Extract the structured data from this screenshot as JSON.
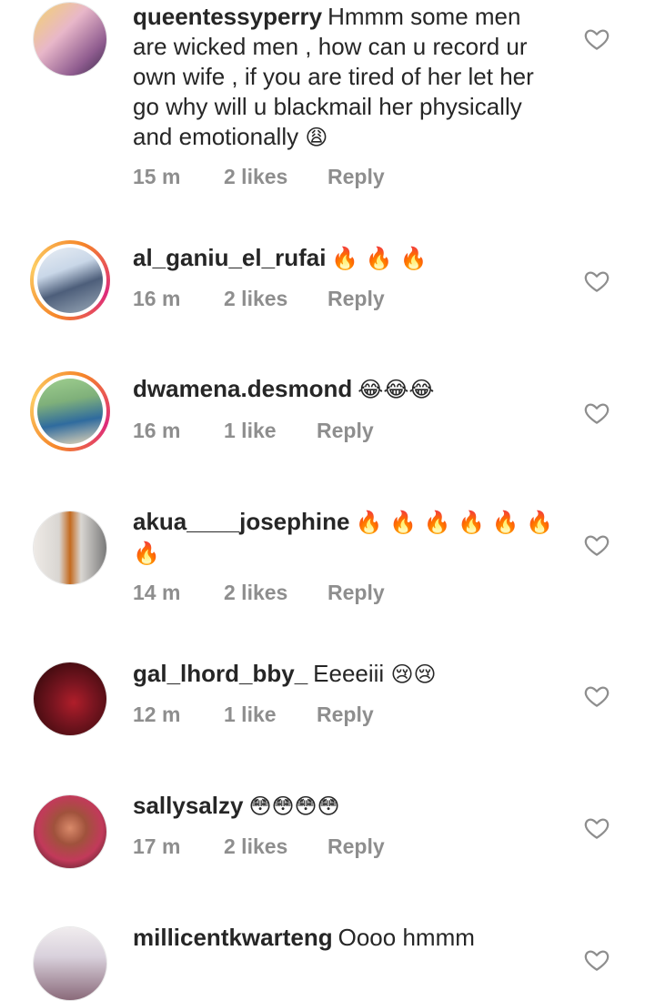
{
  "comments": [
    {
      "username": "queentessyperry",
      "text": "Hmmm some men are wicked men , how can u record ur own wife , if you are tired of her let her go why will u blackmail her physically and emotionally",
      "emoji": "😩",
      "time": "15 m",
      "likes": "2 likes",
      "reply": "Reply",
      "avatar_colors": [
        "#e8b7c9",
        "#f3d36b",
        "#8f5c8f"
      ]
    },
    {
      "username": "al_ganiu_el_rufai",
      "text": "",
      "emoji": "🔥 🔥 🔥",
      "time": "16 m",
      "likes": "2 likes",
      "reply": "Reply",
      "avatar_colors": [
        "#c9d7e8",
        "#4d5e7a",
        "#9aa9b8"
      ]
    },
    {
      "username": "dwamena.desmond",
      "text": "",
      "emoji": "😂😂😂",
      "time": "16 m",
      "likes": "1 like",
      "reply": "Reply",
      "avatar_colors": [
        "#7fb07a",
        "#2f6b9e",
        "#e9d9b8"
      ]
    },
    {
      "username": "akua____josephine",
      "text": "",
      "emoji": "🔥 🔥 🔥 🔥 🔥 🔥 🔥",
      "time": "14 m",
      "likes": "2 likes",
      "reply": "Reply",
      "avatar_colors": [
        "#d9d6d2",
        "#c46a1f",
        "#7a7a7a"
      ]
    },
    {
      "username": "gal_lhord_bby_",
      "text": "Eeeeiii",
      "emoji": "😢😢",
      "time": "12 m",
      "likes": "1 like",
      "reply": "Reply",
      "avatar_colors": [
        "#4a0d12",
        "#b01e2a",
        "#e8e0d8"
      ]
    },
    {
      "username": "sallysalzy",
      "text": "",
      "emoji": "😳😳😳😳",
      "time": "17 m",
      "likes": "2 likes",
      "reply": "Reply",
      "avatar_colors": [
        "#c23a5a",
        "#2a1a1a",
        "#d98a6a"
      ]
    },
    {
      "username": "millicentkwarteng",
      "text": "Oooo hmmm",
      "emoji": "",
      "time": "",
      "likes": "",
      "reply": "",
      "avatar_colors": [
        "#d9d1dc",
        "#8a6a7a",
        "#f0ecee"
      ]
    }
  ],
  "colors": {
    "text": "#262626",
    "meta": "#8e8e8e",
    "heart": "#8e8e8e"
  },
  "icons": {
    "like": "heart-outline-icon"
  }
}
